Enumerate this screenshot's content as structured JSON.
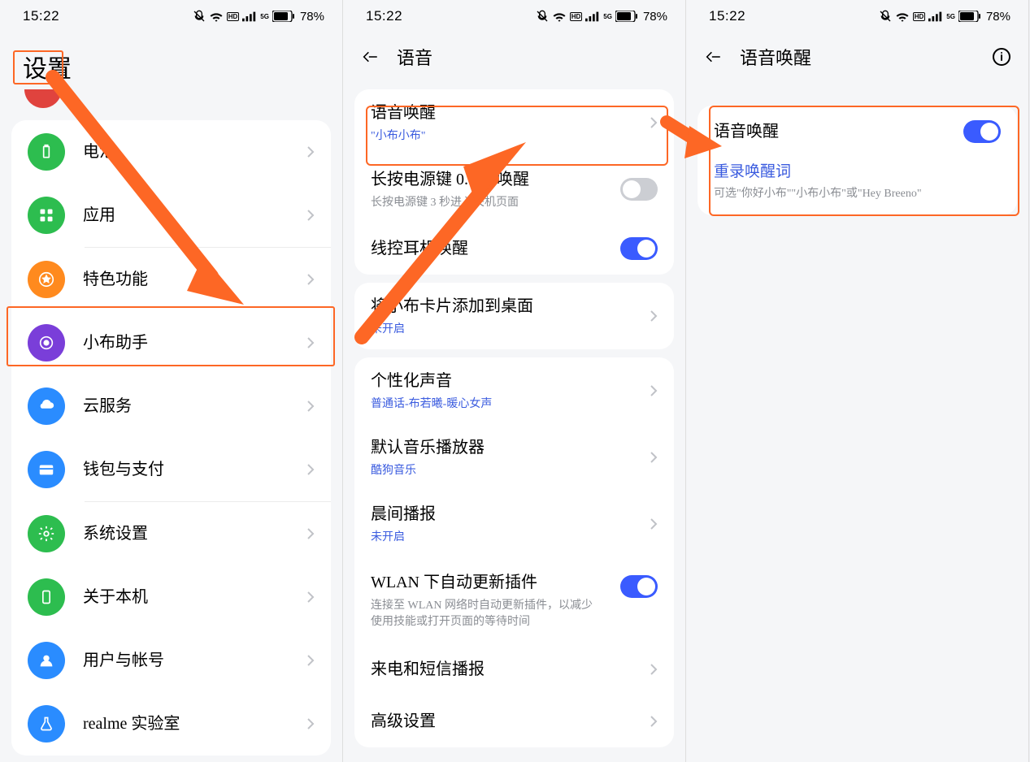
{
  "status": {
    "time": "15:22",
    "battery": "78%"
  },
  "screen1": {
    "title": "设置",
    "items": [
      {
        "label": "电池"
      },
      {
        "label": "应用"
      },
      {
        "label": "特色功能"
      },
      {
        "label": "小布助手"
      },
      {
        "label": "云服务"
      },
      {
        "label": "钱包与支付"
      },
      {
        "label": "系统设置"
      },
      {
        "label": "关于本机"
      },
      {
        "label": "用户与帐号"
      },
      {
        "label": "realme 实验室"
      }
    ]
  },
  "screen2": {
    "title": "语音",
    "group1": [
      {
        "label": "语音唤醒",
        "sub": "\"小布小布\"",
        "type": "nav"
      },
      {
        "label": "长按电源键 0.5 秒唤醒",
        "sub": "长按电源键 3 秒进入关机页面",
        "type": "toggle",
        "on": false
      },
      {
        "label": "线控耳机唤醒",
        "type": "toggle",
        "on": true
      }
    ],
    "group2": [
      {
        "label": "将小布卡片添加到桌面",
        "sub": "未开启"
      }
    ],
    "group3": [
      {
        "label": "个性化声音",
        "sub": "普通话-布若曦-暖心女声",
        "type": "nav"
      },
      {
        "label": "默认音乐播放器",
        "sub": "酷狗音乐",
        "type": "nav"
      },
      {
        "label": "晨间播报",
        "sub": "未开启",
        "type": "nav"
      },
      {
        "label": "WLAN 下自动更新插件",
        "sub": "连接至 WLAN 网络时自动更新插件，以减少使用技能或打开页面的等待时间",
        "type": "toggle",
        "on": true
      },
      {
        "label": "来电和短信播报",
        "type": "nav"
      },
      {
        "label": "高级设置",
        "type": "nav"
      }
    ]
  },
  "screen3": {
    "title": "语音唤醒",
    "toggle_label": "语音唤醒",
    "rerecord": "重录唤醒词",
    "rerecord_sub": "可选\"你好小布\"\"小布小布\"或\"Hey Breeno\""
  }
}
